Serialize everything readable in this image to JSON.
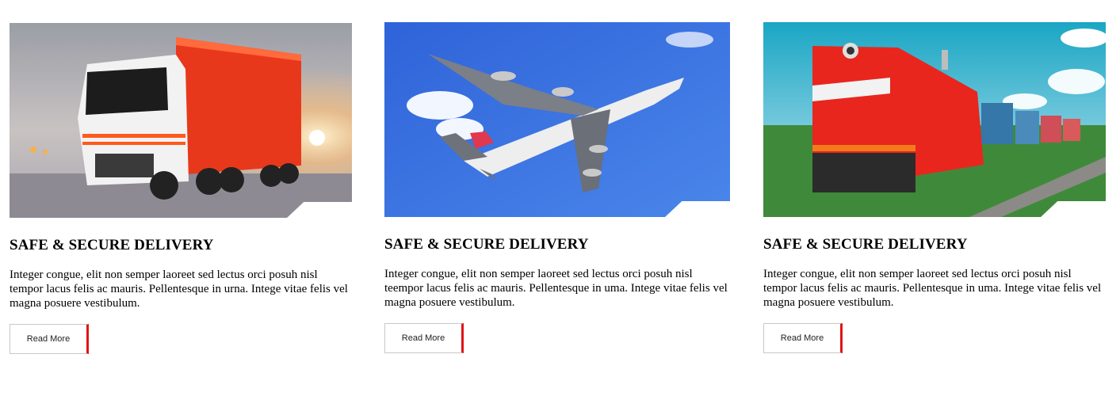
{
  "cards": [
    {
      "image": "truck-photo",
      "title": "SAFE & SECURE DELIVERY",
      "text": "Integer congue, elit non semper laoreet sed lectus orci posuh nisl tempor lacus felis ac mauris. Pellentesque in urna. Intege vitae felis vel magna posuere vestibulum.",
      "button": "Read More"
    },
    {
      "image": "airplane-photo",
      "title": "SAFE & SECURE DELIVERY",
      "text": "Integer congue, elit non semper laoreet sed lectus orci posuh nisl teempor lacus felis ac mauris. Pellentesque in uma. Intege vitae felis vel magna posuere vestibulum.",
      "button": "Read More"
    },
    {
      "image": "train-photo",
      "title": "SAFE & SECURE DELIVERY",
      "text": "Integer congue, elit non semper laoreet sed lectus orci posuh nisl tempor lacus felis ac mauris. Pellentesque in uma. Intege vitae felis vel magna posuere vestibulum.",
      "button": "Read More"
    }
  ],
  "colors": {
    "accent": "#e01515",
    "button_border": "#c8c8c8"
  }
}
